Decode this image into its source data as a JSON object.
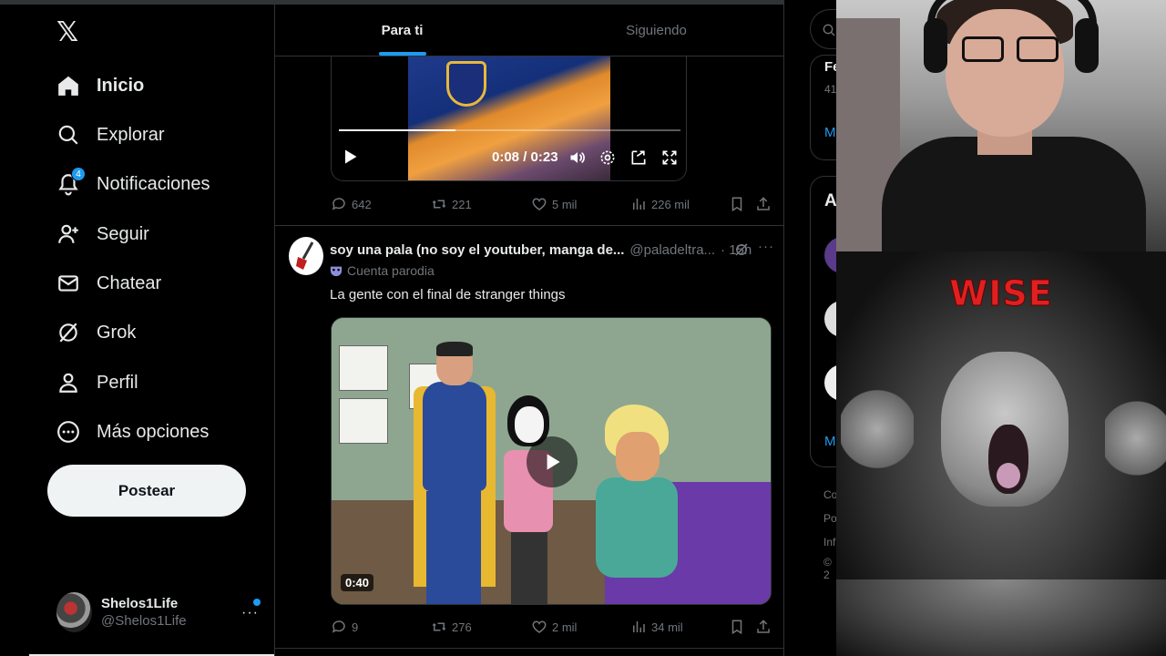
{
  "app": {
    "logo": "𝕏"
  },
  "nav": {
    "items": [
      {
        "label": "Inicio",
        "icon": "home-icon",
        "active": true
      },
      {
        "label": "Explorar",
        "icon": "search-icon"
      },
      {
        "label": "Notificaciones",
        "icon": "bell-icon",
        "badge": "4"
      },
      {
        "label": "Seguir",
        "icon": "add-user-icon"
      },
      {
        "label": "Chatear",
        "icon": "mail-icon"
      },
      {
        "label": "Grok",
        "icon": "grok-icon"
      },
      {
        "label": "Perfil",
        "icon": "user-icon"
      },
      {
        "label": "Más opciones",
        "icon": "more-circle-icon"
      }
    ],
    "post_button": "Postear"
  },
  "account": {
    "name": "Shelos1Life",
    "handle": "@Shelos1Life",
    "more": "···"
  },
  "tabs": [
    {
      "label": "Para ti",
      "active": true
    },
    {
      "label": "Siguiendo",
      "active": false
    }
  ],
  "tweet1": {
    "video": {
      "time": "0:08 / 0:23",
      "progress": 0.34
    },
    "stats": {
      "replies": "642",
      "retweets": "221",
      "likes": "5 mil",
      "views": "226 mil"
    }
  },
  "tweet2": {
    "name": "soy una pala (no soy el youtuber, manga de...",
    "handle": "@paladeltra...",
    "time": "· 15h",
    "more": "···",
    "parody": "Cuenta parodia",
    "text": "La gente con el final de stranger things",
    "video": {
      "duration": "0:40"
    },
    "stats": {
      "replies": "9",
      "retweets": "276",
      "likes": "2 mil",
      "views": "34 mil"
    }
  },
  "right": {
    "frag_fe": "Fe",
    "frag_41": "41",
    "frag_m1": "M",
    "frag_a": "A",
    "frag_m2": "M",
    "footer": [
      "Co",
      "Pol",
      "Inf",
      "© 2"
    ]
  },
  "overlay": {
    "meme_title": "WISE"
  },
  "colors": {
    "accent": "#1d9bf0",
    "background": "#000000",
    "text": "#e7e9ea",
    "muted": "#71767b",
    "border": "#2f3336",
    "meme_title": "#e02020"
  }
}
